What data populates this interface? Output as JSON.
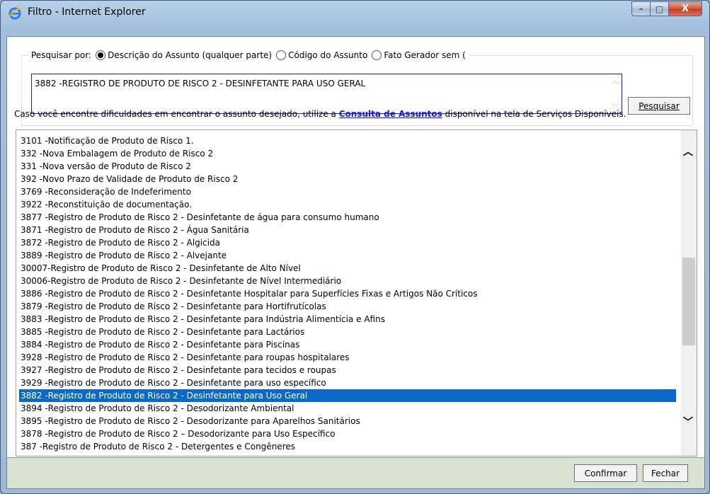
{
  "window": {
    "title": "Filtro - Internet Explorer",
    "controls": {
      "minimize": "–",
      "maximize": "□",
      "close": "X"
    }
  },
  "search": {
    "legend_label": "Pesquisar por:",
    "options": [
      {
        "label": "Descrição do Assunto (qualquer parte)",
        "selected": true
      },
      {
        "label": "Código do Assunto",
        "selected": false
      },
      {
        "label": "Fato Gerador sem (",
        "selected": false
      }
    ],
    "value": "3882 -REGISTRO DE PRODUTO DE RISCO 2 - DESINFETANTE PARA USO GERAL",
    "button_label": "Pesquisar"
  },
  "hint": {
    "before": "Caso você encontre dificuldades em encontrar o assunto desejado, utilize a ",
    "link": "Consulta de Assuntos",
    "after": " disponível na tela de Serviços Disponíveis."
  },
  "list": {
    "items": [
      "3101 -Notificação de Produto de Risco 1.",
      "332 -Nova Embalagem de Produto de Risco 2",
      "331 -Nova versão de Produto de Risco 2",
      "392 -Novo Prazo de Validade de Produto de Risco 2",
      "3769 -Reconsideração de Indeferimento",
      "3922 -Reconstituição de documentação.",
      "3877 -Registro de Produto de Risco 2 - Desinfetante de água para consumo humano",
      "3871 -Registro de Produto de Risco 2 - Água Sanitária",
      "3872 -Registro de Produto de Risco 2 - Algicida",
      "3889 -Registro de Produto de Risco 2 - Alvejante",
      "30007-Registro de Produto de Risco 2 - Desinfetante de Alto Nível",
      "30006-Registro de Produto de Risco 2 - Desinfetante de Nível Intermediário",
      "3886 -Registro de Produto de Risco 2 - Desinfetante Hospitalar para Superfícies Fixas e Artigos Não Críticos",
      "3879 -Registro de Produto de Risco 2 - Desinfetante para Hortifrutícolas",
      "3883 -Registro de Produto de Risco 2 - Desinfetante para Indústria Alimentícia e Afins",
      "3885 -Registro de Produto de Risco 2 - Desinfetante para Lactários",
      "3884 -Registro de Produto de Risco 2 - Desinfetante para Piscinas",
      "3928 -Registro de Produto de Risco 2 - Desinfetante para roupas hospitalares",
      "3927 -Registro de Produto de Risco 2 - Desinfetante para tecidos e roupas",
      "3929 -Registro de Produto de Risco 2 - Desinfetante para uso específico",
      "3882 -Registro de Produto de Risco 2 - Desinfetante para Uso Geral",
      "3894 -Registro de Produto de Risco 2 - Desodorizante Ambiental",
      "3895 -Registro de Produto de Risco 2 - Desodorizante para Aparelhos Sanitários",
      "3878 -Registro de Produto de Risco 2 – Desodorizante para Uso Específico",
      "387 -Registro de Produto de Risco 2 - Detergentes e Congêneres"
    ],
    "selected_index": 20
  },
  "footer": {
    "confirm_label": "Confirmar",
    "close_label": "Fechar"
  },
  "colors": {
    "selection": "#0a68c8",
    "link": "#1a1ad6",
    "footer_bg": "#d9e2d2"
  }
}
